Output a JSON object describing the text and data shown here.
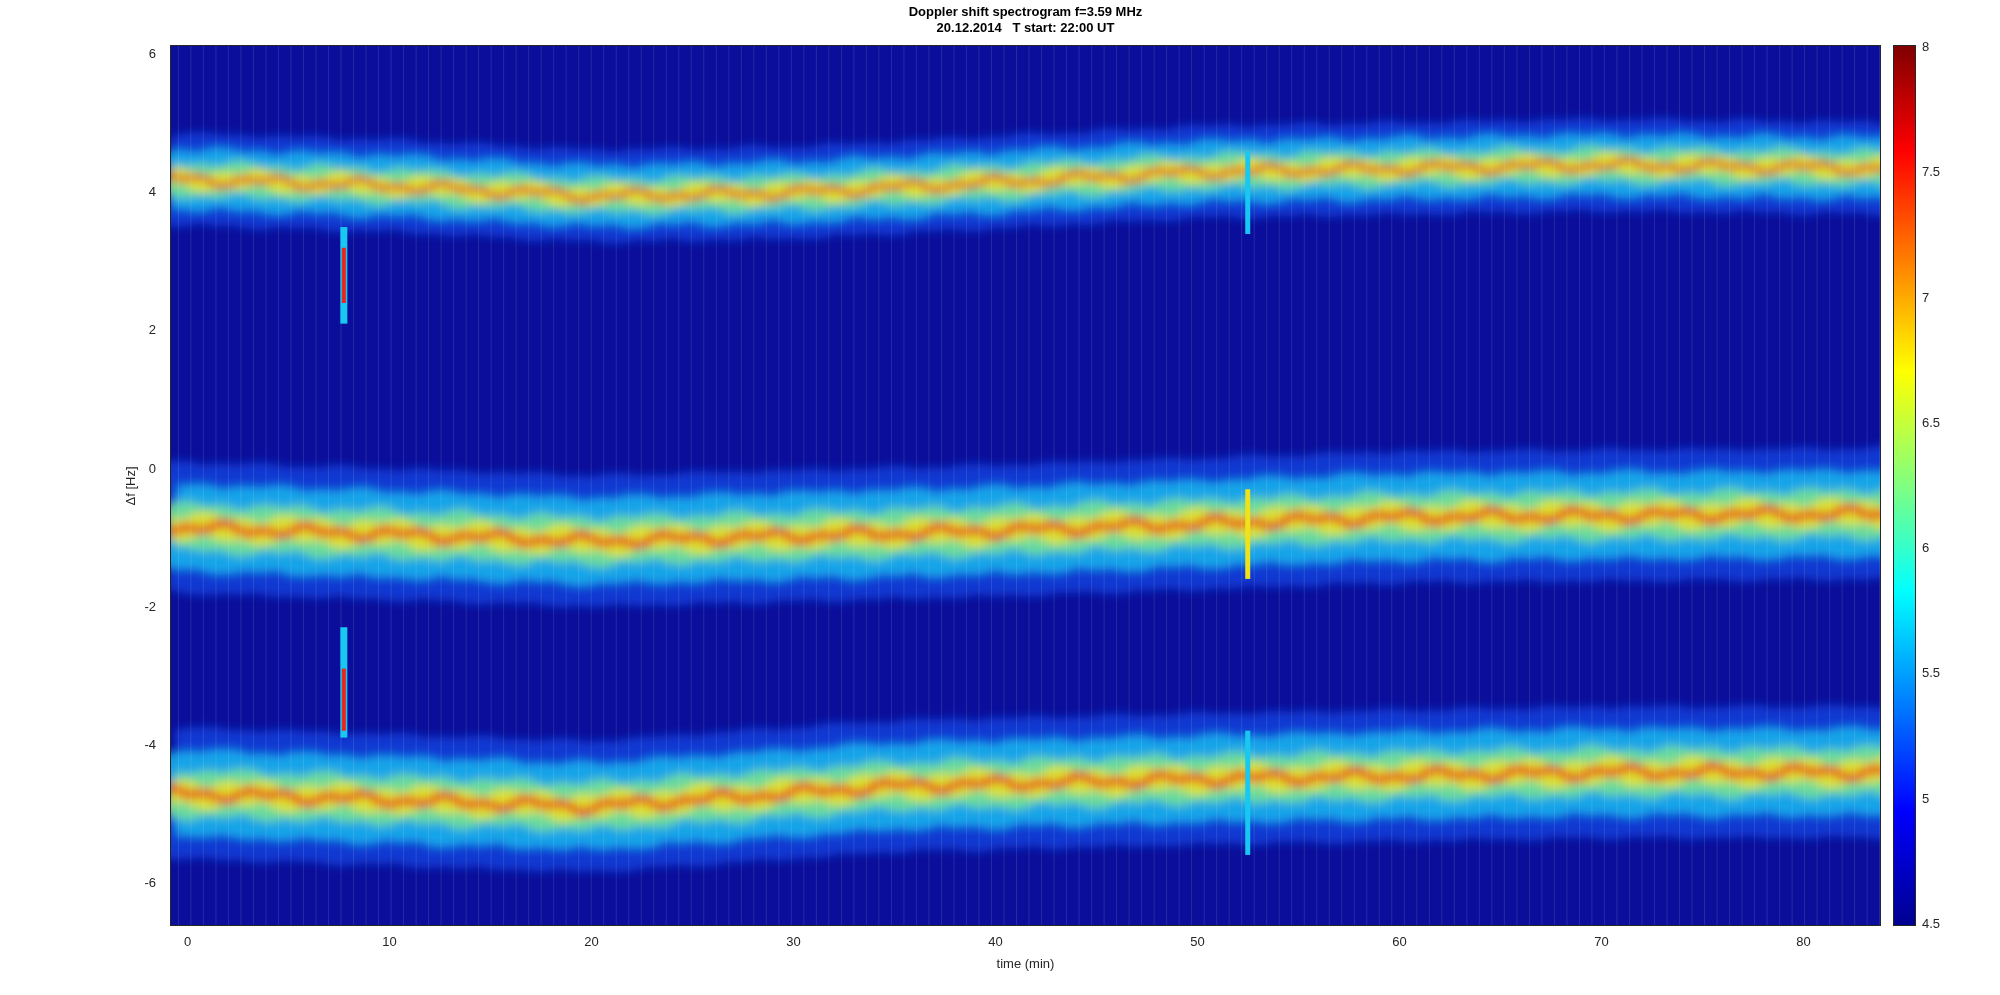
{
  "title": {
    "line_1": "Doppler shift spectrogram f=3.59 MHz",
    "line_2": "20.12.2014   T start: 22:00 UT"
  },
  "axes": {
    "ylabel": "Δf [Hz]",
    "xlabel": "time (min)",
    "yticks": [
      "6",
      "4",
      "2",
      "0",
      "-2",
      "-4",
      "-6"
    ],
    "xticks": [
      "0",
      "10",
      "20",
      "30",
      "40",
      "50",
      "60",
      "70",
      "80"
    ]
  },
  "colorbar": {
    "ticks": [
      "8",
      "7.5",
      "7",
      "6.5",
      "6",
      "5.5",
      "5",
      "4.5"
    ]
  }
}
